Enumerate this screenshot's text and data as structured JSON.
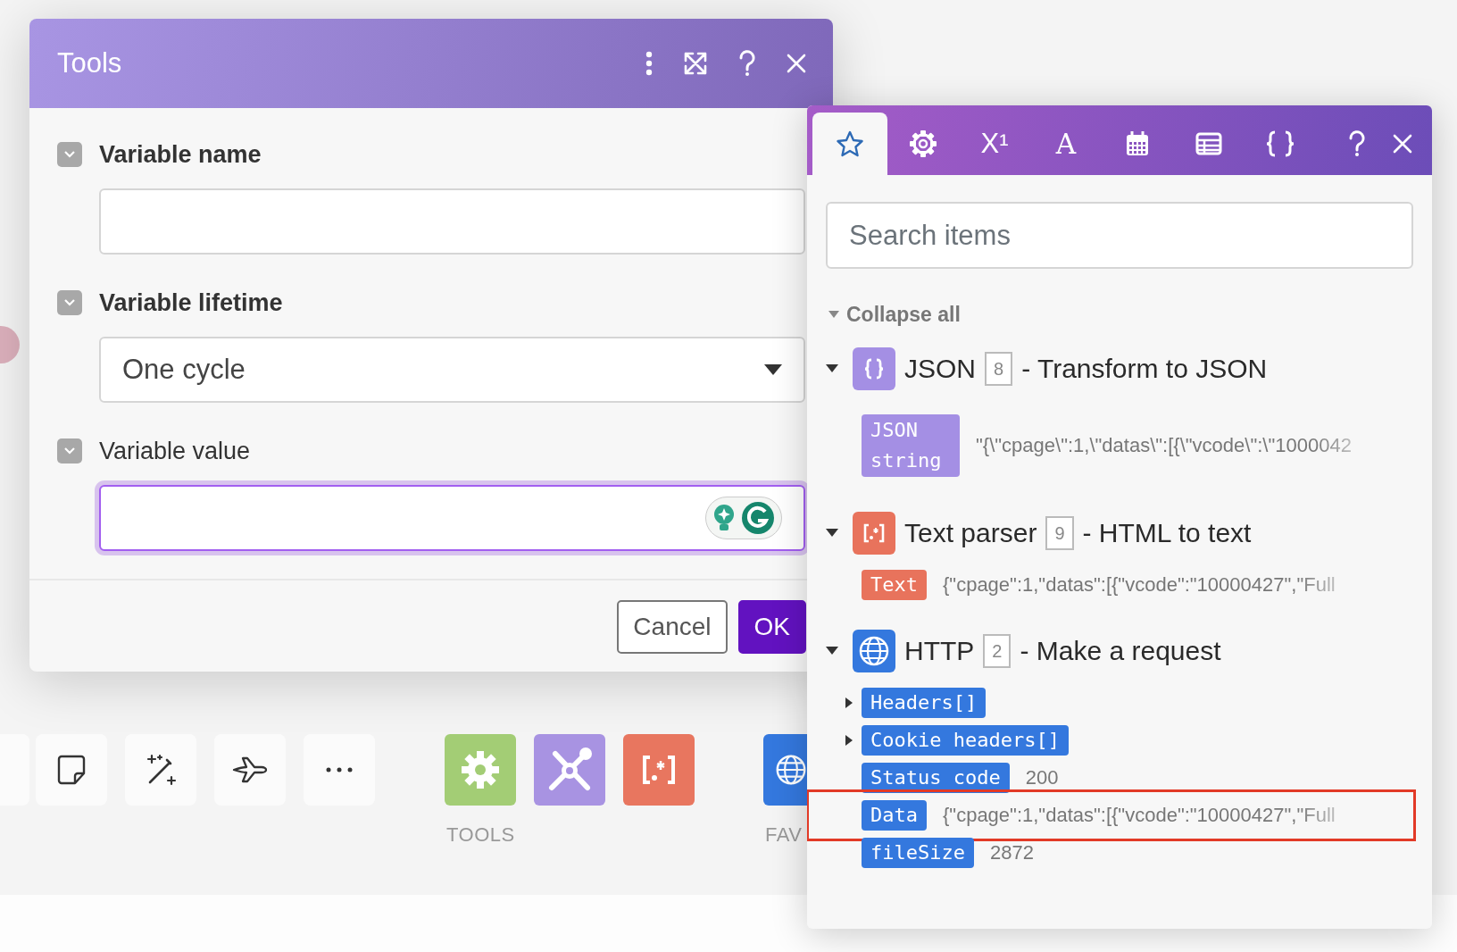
{
  "dialog": {
    "title": "Tools",
    "fields": [
      {
        "kind": "text",
        "label": "Variable name",
        "required": true
      },
      {
        "kind": "select",
        "label": "Variable lifetime",
        "required": true,
        "value": "One cycle"
      },
      {
        "kind": "textarea",
        "label": "Variable value",
        "required": false,
        "focused": true
      }
    ],
    "buttons": [
      {
        "kind": "secondary",
        "label": "Cancel"
      },
      {
        "kind": "primary",
        "label": "OK"
      }
    ]
  },
  "panel": {
    "tabs": [
      {
        "kind": "favorites",
        "selected": true
      },
      {
        "kind": "general",
        "selected": false
      },
      {
        "kind": "math",
        "label": "X¹",
        "selected": false
      },
      {
        "kind": "text",
        "label": "A",
        "selected": false
      },
      {
        "kind": "date",
        "selected": false
      },
      {
        "kind": "array",
        "selected": false
      },
      {
        "kind": "json",
        "selected": false
      }
    ],
    "search": {
      "placeholder": "Search items"
    },
    "collapse_all": "Collapse all",
    "modules": [
      {
        "kind": "json",
        "name": "JSON",
        "number": "8",
        "description": "- Transform to JSON",
        "expanded": true,
        "color": "#a48fe4",
        "items": [
          {
            "label": "JSON string",
            "value": "\"{\\\"cpage\\\":1,\\\"datas\\\":[{\\\"vcode\\\":\\\"1000042",
            "expandable": false,
            "highlighted": false
          }
        ]
      },
      {
        "kind": "text-parser",
        "name": "Text parser",
        "number": "9",
        "description": "- HTML to text",
        "expanded": true,
        "color": "#e8735c",
        "items": [
          {
            "label": "Text",
            "value": "{\"cpage\":1,\"datas\":[{\"vcode\":\"10000427\",\"Full",
            "expandable": false,
            "highlighted": false
          }
        ]
      },
      {
        "kind": "http",
        "name": "HTTP",
        "number": "2",
        "description": "- Make a request",
        "expanded": true,
        "color": "#3478de",
        "items": [
          {
            "label": "Headers[]",
            "expandable": true,
            "expanded": false,
            "highlighted": false
          },
          {
            "label": "Cookie headers[]",
            "expandable": true,
            "expanded": false,
            "highlighted": false
          },
          {
            "label": "Status code",
            "value": "200",
            "expandable": false,
            "highlighted": false
          },
          {
            "label": "Data",
            "value": "{\"cpage\":1,\"datas\":[{\"vcode\":\"10000427\",\"Full",
            "expandable": false,
            "highlighted": true
          },
          {
            "label": "fileSize",
            "value": "2872",
            "expandable": false,
            "highlighted": false
          }
        ]
      }
    ]
  },
  "toolbar": {
    "buttons": [
      {
        "kind": "partial"
      },
      {
        "kind": "note"
      },
      {
        "kind": "magic"
      },
      {
        "kind": "flow"
      },
      {
        "kind": "more"
      }
    ],
    "groups": [
      {
        "label": "TOOLS",
        "apps": [
          {
            "kind": "gear",
            "color": "#a3cd75"
          },
          {
            "kind": "tools",
            "color": "#a893e2"
          },
          {
            "kind": "text-parser",
            "color": "#e8765f"
          }
        ]
      },
      {
        "label": "FAV",
        "apps": [
          {
            "kind": "http",
            "color": "#3478de"
          }
        ]
      }
    ]
  }
}
